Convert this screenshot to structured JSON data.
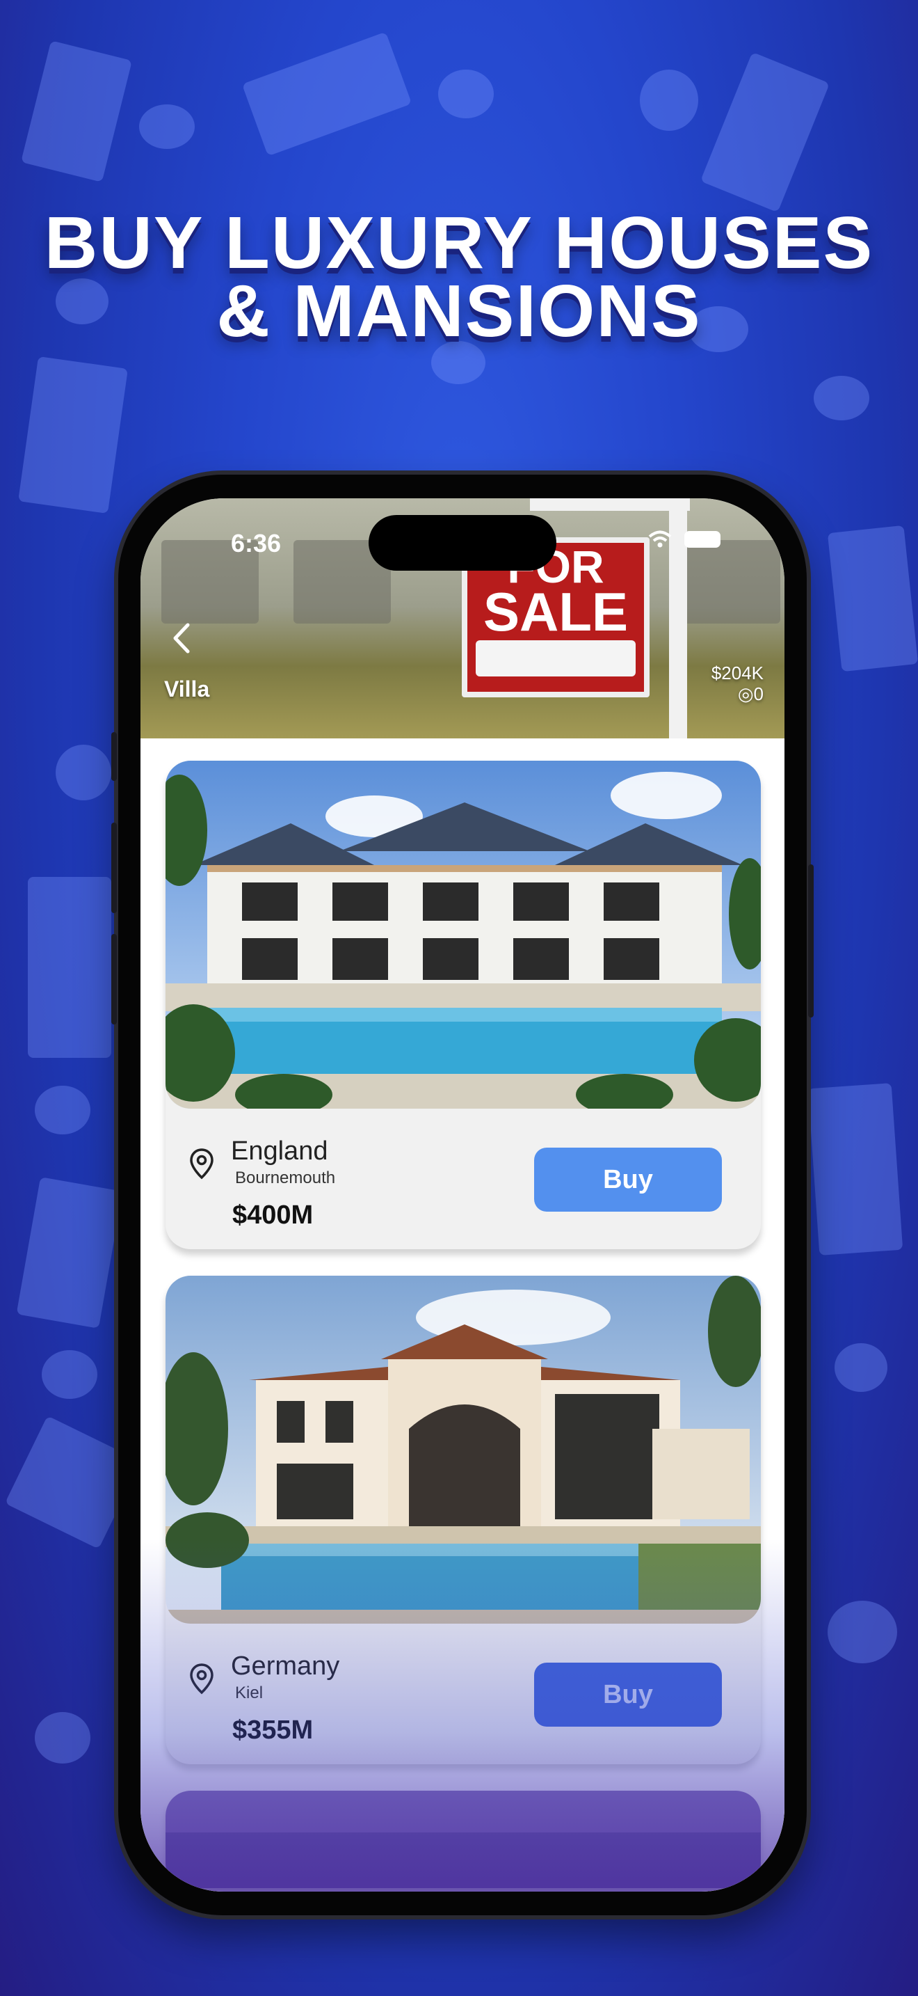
{
  "headline": {
    "line1": "BUY LUXURY HOUSES",
    "line2": "& MANSIONS"
  },
  "status_bar": {
    "time": "6:36",
    "wifi_icon": "wifi-icon",
    "battery_icon": "battery-icon"
  },
  "header": {
    "category": "Villa",
    "balance": "$204K",
    "count": "◎0",
    "sign_line1": "FOR",
    "sign_line2": "SALE",
    "back_icon": "chevron-left-icon"
  },
  "listings": [
    {
      "country": "England",
      "city": "Bournemouth",
      "price": "$400M",
      "button": "Buy",
      "pin_icon": "location-pin-icon"
    },
    {
      "country": "Germany",
      "city": "Kiel",
      "price": "$355M",
      "button": "Buy",
      "pin_icon": "location-pin-icon"
    }
  ],
  "colors": {
    "background": "#2446cc",
    "button": "#5390ee",
    "sign": "#b71c1c"
  }
}
